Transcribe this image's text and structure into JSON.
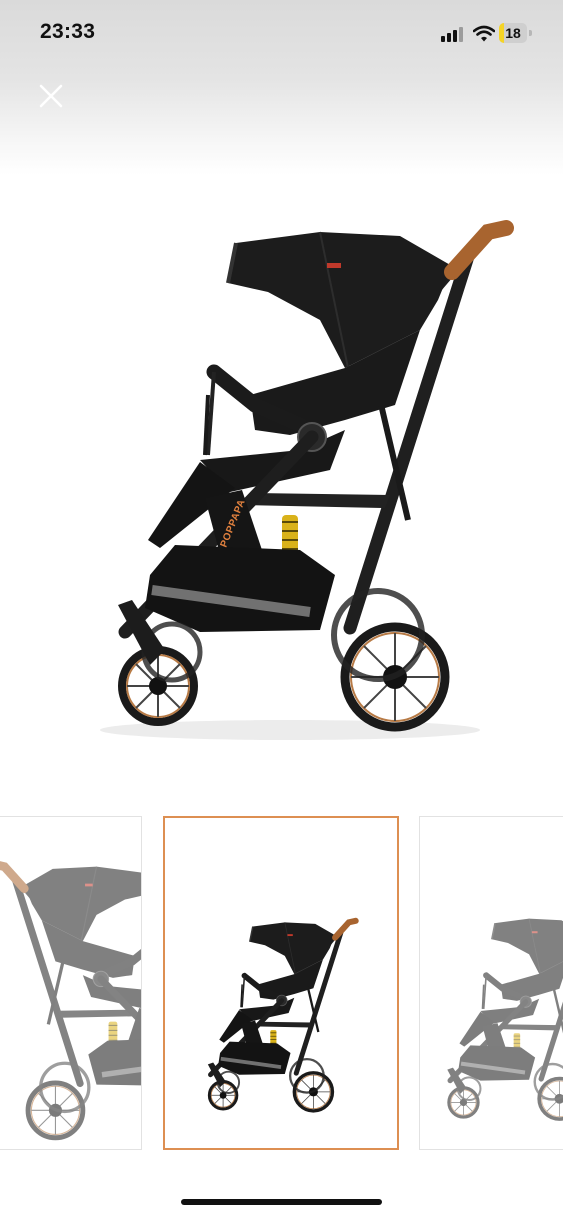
{
  "status_bar": {
    "time": "23:33",
    "battery_level": "18",
    "battery_fraction": 0.18,
    "icons": [
      "cellular-signal-icon",
      "wifi-icon",
      "battery-icon"
    ]
  },
  "header": {
    "close_icon": "close-icon"
  },
  "gallery": {
    "main_image": "black-stroller-side-view",
    "brand_text": "POPPAPA",
    "selected_index": 1,
    "thumbnails": [
      {
        "image": "stroller-front-three-quarter-view",
        "selected": false
      },
      {
        "image": "black-stroller-side-view",
        "selected": true
      },
      {
        "image": "stroller-partial-side-view",
        "selected": false
      }
    ]
  },
  "colors": {
    "accent": "#dd8f52",
    "stroller_black": "#1b1b1b",
    "handle_leather": "#a8642f",
    "spring_yellow": "#d9b21a"
  }
}
